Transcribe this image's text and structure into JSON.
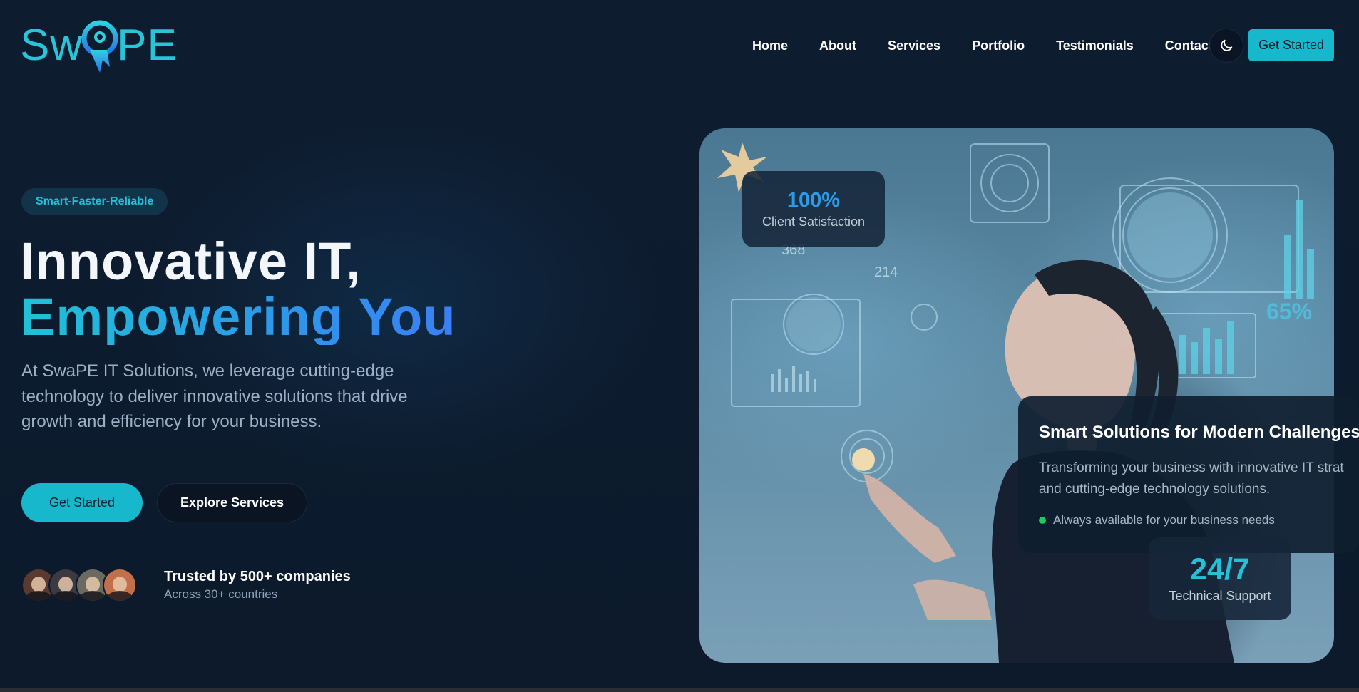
{
  "brand": {
    "logo_text_left": "Sw",
    "logo_text_right": "PE",
    "accent_color": "#17b8cb",
    "gradient_colors": [
      "#1fc2d6",
      "#3b7ff5"
    ]
  },
  "nav": {
    "items": [
      "Home",
      "About",
      "Services",
      "Portfolio",
      "Testimonials",
      "Contact"
    ],
    "theme_icon": "moon-icon",
    "cta_label": "Get Started"
  },
  "hero": {
    "badge": "Smart-Faster-Reliable",
    "headline_line1": "Innovative IT,",
    "headline_line2": "Empowering You",
    "description": "At SwaPE IT Solutions, we leverage cutting-edge technology to deliver innovative solutions that drive growth and efficiency for your business.",
    "primary_button": "Get Started",
    "secondary_button": "Explore Services",
    "trust_title": "Trusted by 500+ companies",
    "trust_subtitle": "Across 30+ countries",
    "avatar_colors": [
      "#5a3a2e",
      "#3a3a40",
      "#6b6a60",
      "#c2704a"
    ]
  },
  "showcase": {
    "stat_top_value": "100%",
    "stat_top_label": "Client Satisfaction",
    "card_title": "Smart Solutions for Modern Challenges",
    "card_text_line1": "Transforming your business with innovative IT strat",
    "card_text_line2": "and cutting-edge technology solutions.",
    "card_status": "Always available for your business needs",
    "stat_bottom_value": "24/7",
    "stat_bottom_label": "Technical Support",
    "hud_text": [
      "368",
      "214",
      "65%"
    ]
  }
}
